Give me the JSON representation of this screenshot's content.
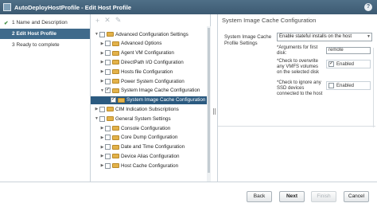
{
  "window": {
    "title": "AutoDeployHostProfile - Edit Host Profile",
    "help_label": "?"
  },
  "steps": [
    {
      "number": "1",
      "label": "Name and Description",
      "state": "done"
    },
    {
      "number": "2",
      "label": "Edit Host Profile",
      "state": "active"
    },
    {
      "number": "3",
      "label": "Ready to complete",
      "state": "pending"
    }
  ],
  "toolbar": {
    "add_icon": "+",
    "remove_icon": "✕",
    "edit_icon": "✎"
  },
  "tree": [
    {
      "label": "Advanced Configuration Settings",
      "level": 0,
      "expanded": true,
      "checked": false,
      "selected": false
    },
    {
      "label": "Advanced Options",
      "level": 1,
      "expanded": false,
      "checked": false,
      "selected": false
    },
    {
      "label": "Agent VM Configuration",
      "level": 1,
      "expanded": false,
      "checked": false,
      "selected": false
    },
    {
      "label": "DirectPath I/O Configuration",
      "level": 1,
      "expanded": false,
      "checked": false,
      "selected": false
    },
    {
      "label": "Hosts file Configuration",
      "level": 1,
      "expanded": false,
      "checked": false,
      "selected": false
    },
    {
      "label": "Power System Configuration",
      "level": 1,
      "expanded": false,
      "checked": false,
      "selected": false
    },
    {
      "label": "System Image Cache Configuration",
      "level": 1,
      "expanded": true,
      "checked": true,
      "selected": false
    },
    {
      "label": "System Image Cache Configuration",
      "level": 2,
      "expanded": null,
      "checked": true,
      "selected": true
    },
    {
      "label": "CIM Indication Subscriptions",
      "level": 0,
      "expanded": false,
      "checked": false,
      "selected": false
    },
    {
      "label": "General System Settings",
      "level": 0,
      "expanded": true,
      "checked": false,
      "selected": false
    },
    {
      "label": "Console Configuration",
      "level": 1,
      "expanded": false,
      "checked": false,
      "selected": false
    },
    {
      "label": "Core Dump Configuration",
      "level": 1,
      "expanded": false,
      "checked": false,
      "selected": false
    },
    {
      "label": "Date and Time Configuration",
      "level": 1,
      "expanded": false,
      "checked": false,
      "selected": false
    },
    {
      "label": "Device Alias Configuration",
      "level": 1,
      "expanded": false,
      "checked": false,
      "selected": false
    },
    {
      "label": "Host Cache Configuration",
      "level": 1,
      "expanded": false,
      "checked": false,
      "selected": false
    }
  ],
  "settings": {
    "header": "System Image Cache Configuration",
    "profile_label": "System Image Cache Profile Settings",
    "policy_value": "Enable stateful installs on the host",
    "args_label": "*Arguments for first disk:",
    "args_value": "remote",
    "overwrite_label": "*Check to overwrite any VMFS volumes on the selected disk",
    "overwrite_value": "Enabled",
    "ignore_ssd_label": "*Check to ignore any SSD devices connected to the host",
    "ignore_ssd_value": "Enabled"
  },
  "buttons": {
    "back": "Back",
    "next": "Next",
    "finish": "Finish",
    "cancel": "Cancel"
  },
  "colors": {
    "titlebar": "#3c5a72",
    "active_step": "#3f6a8b",
    "selected_row": "#2b5a80"
  }
}
